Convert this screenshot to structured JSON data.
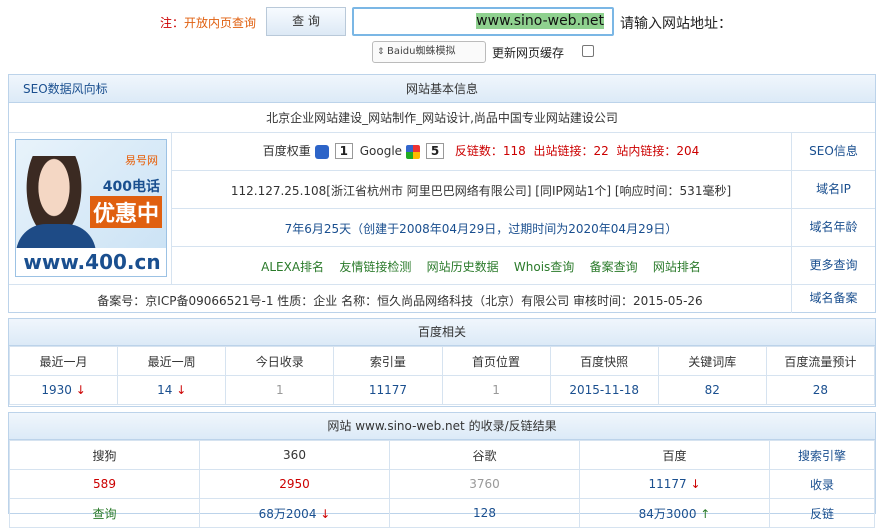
{
  "search": {
    "label": "请输入网站地址：",
    "url_value": "www.sino-web.net",
    "submit_label": "查 询",
    "note_prefix": "注：",
    "note_text": "开放内页查询",
    "checkbox_label": "更新网页缓存",
    "select_value": "Baidu蜘蛛模拟"
  },
  "basic": {
    "header": "网站基本信息",
    "header_right": "SEO数据风向标",
    "title": "北京企业网站建设_网站制作_网站设计,尚品中国专业网站建设公司",
    "rows": [
      {
        "label": "SEO信息",
        "baidu_weight": "百度权重",
        "baidu_val": "1",
        "google": "Google",
        "google_val": "5",
        "backlinks": "反链数：118",
        "outlinks": "出站链接：22",
        "inlinks": "站内链接：204"
      },
      {
        "label": "域名IP",
        "text": "112.127.25.108[浙江省杭州市 阿里巴巴网络有限公司] [同IP网站1个] [响应时间：531毫秒]"
      },
      {
        "label": "域名年龄",
        "text": "7年6月25天（创建于2008年04月29日，过期时间为2020年04月29日）"
      },
      {
        "label": "更多查询",
        "links": [
          "ALEXA排名",
          "友情链接检测",
          "网站历史数据",
          "Whois查询",
          "备案查询",
          "网站排名"
        ]
      },
      {
        "label": "域名备案",
        "text": "备案号：京ICP备09066521号-1  性质：企业  名称：恒久尚品网络科技（北京）有限公司  审核时间：2015-05-26"
      }
    ],
    "ad": {
      "brand": "易号网",
      "line1": "400电话",
      "line2": "优惠中",
      "url": "www.400.cn"
    }
  },
  "baidu": {
    "header": "百度相关",
    "columns": [
      "百度流量预计",
      "关键词库",
      "百度快照",
      "首页位置",
      "索引量",
      "今日收录",
      "最近一周",
      "最近一月"
    ],
    "values": [
      "28",
      "82",
      "2015-11-18",
      "1",
      "11177",
      "1",
      "14",
      "1930"
    ]
  },
  "index": {
    "header": "网站 www.sino-web.net 的收录/反链结果",
    "columns": [
      "搜索引擎",
      "百度",
      "谷歌",
      "360",
      "搜狗"
    ],
    "rows": [
      [
        "收录",
        "11177",
        "3760",
        "2950",
        "589"
      ],
      [
        "反链",
        "84万3000",
        "128",
        "68万2004",
        "查询"
      ]
    ]
  }
}
